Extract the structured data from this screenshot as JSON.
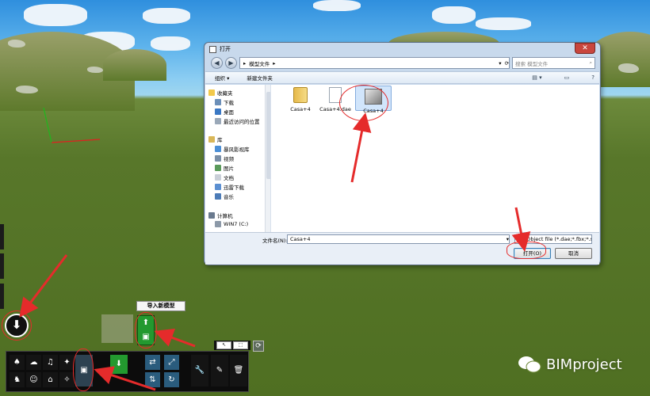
{
  "dialog": {
    "title": "打开",
    "close_label": "✕",
    "breadcrumb": {
      "separator": "▸",
      "folder": "模型文件",
      "dropdown": "▾",
      "refresh": "⟳"
    },
    "search_placeholder": "搜索 模型文件",
    "toolbar": {
      "organize": "组织 ▾",
      "new_folder": "新建文件夹",
      "view_icon": "▤ ▾",
      "help_icon": "?"
    },
    "nav": {
      "favorites": "收藏夹",
      "favorites_items": [
        "下载",
        "桌面",
        "最近访问的位置"
      ],
      "libraries": "库",
      "libraries_items": [
        "暴风影视库",
        "视频",
        "图片",
        "文档",
        "迅雷下载",
        "音乐"
      ],
      "computer": "计算机",
      "computer_items": [
        "WIN7 (C:)"
      ]
    },
    "files": [
      {
        "name": "Casa+4",
        "type": "folder"
      },
      {
        "name": "Casa+4.dae",
        "type": "document"
      },
      {
        "name": "Casa+4",
        "type": "model",
        "selected": true
      }
    ],
    "filename_label": "文件名(N):",
    "filename_value": "Casa+4",
    "filter_value": "3D Object file (*.dae;*.fbx;*.s",
    "open_button": "打开(O)",
    "cancel_button": "取消"
  },
  "app": {
    "import_tooltip": "导入新模型",
    "mode_icons": [
      "↖",
      "⬚"
    ],
    "watermark": "BIMproject"
  },
  "colors": {
    "annotation": "#e52b2b",
    "green_button": "#23992f"
  }
}
